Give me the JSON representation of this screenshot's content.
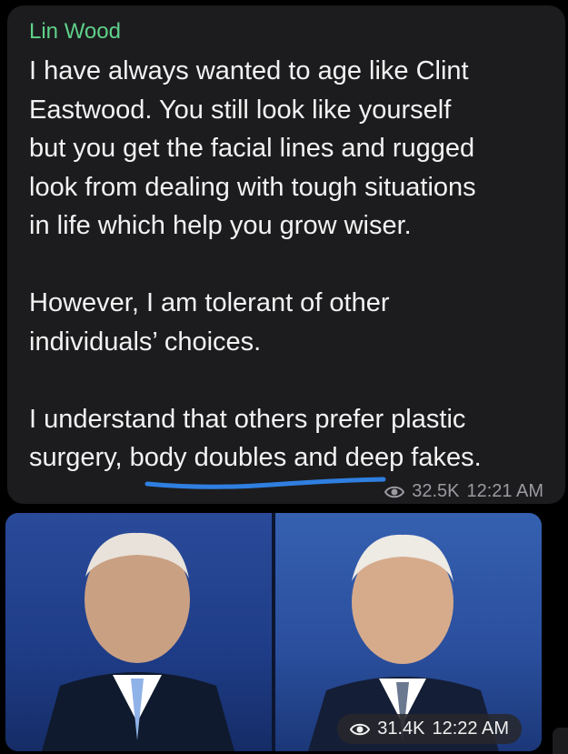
{
  "message": {
    "sender": "Lin Wood",
    "text": "I have always wanted to age like Clint\nEastwood. You still look like yourself\nbut you get the facial lines and rugged\nlook from dealing with tough situations\nin life which help you grow wiser.\n\nHowever, I am tolerant of other\nindividuals’ choices.\n\nI understand that others prefer plastic\nsurgery, body doubles and deep fakes.",
    "views": "32.5K",
    "time": "12:21 AM"
  },
  "photo_message": {
    "views": "31.4K",
    "time": "12:22 AM"
  },
  "colors": {
    "bubble": "#1c1c1e",
    "sender": "#5fd08a",
    "underline": "#2f7fe0"
  }
}
